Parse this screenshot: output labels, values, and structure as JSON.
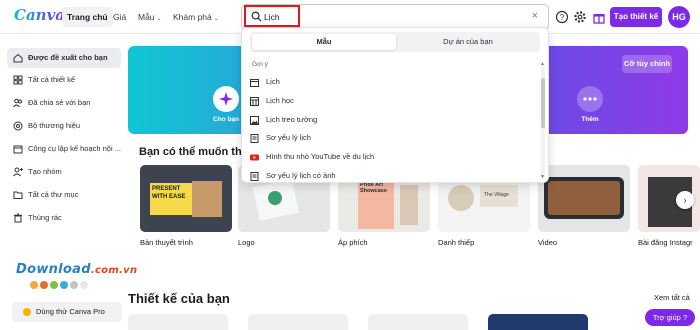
{
  "app": {
    "logo": "Canva"
  },
  "nav": [
    {
      "label": "Trang chủ",
      "active": true
    },
    {
      "label": "Giá"
    },
    {
      "label": "Mẫu",
      "caret": "⌄"
    },
    {
      "label": "Khám phá",
      "caret": "⌄"
    }
  ],
  "search": {
    "value": "Lịch",
    "placeholder": ""
  },
  "topbar": {
    "create_label": "Tạo thiết kế",
    "avatar": "HG"
  },
  "sidebar": {
    "items": [
      {
        "label": "Được đề xuất cho bạn",
        "icon": "home-icon",
        "active": true
      },
      {
        "label": "Tất cả thiết kế",
        "icon": "grid-icon"
      },
      {
        "label": "Đã chia sẻ với bạn",
        "icon": "users-icon"
      },
      {
        "label": "Bộ thương hiệu",
        "icon": "brand-icon"
      },
      {
        "label": "Công cụ lập kế hoạch nội ...",
        "icon": "calendar-icon"
      },
      {
        "label": "Tạo nhóm",
        "icon": "add-team-icon"
      },
      {
        "label": "Tất cả thư mục",
        "icon": "folder-icon"
      },
      {
        "label": "Thùng rác",
        "icon": "trash-icon"
      }
    ],
    "pro_label": "Dùng thử Canva Pro"
  },
  "watermark": {
    "main": "Download",
    "suffix": ".com.vn"
  },
  "banner": {
    "custom_label": "Cỡ tùy chỉnh",
    "categories": [
      {
        "label": "Cho bạn",
        "active": true
      },
      {
        "label": "Thêm"
      }
    ]
  },
  "section": {
    "title": "Bạn có thể muốn thử...",
    "tiles": [
      {
        "label": "Bản thuyết trình",
        "text": "PRESENT WITH EASE"
      },
      {
        "label": "Logo"
      },
      {
        "label": "Áp phích",
        "text": "Pride Art Showcase"
      },
      {
        "label": "Danh thiếp",
        "text": "The Village"
      },
      {
        "label": "Video"
      },
      {
        "label": "Bài đăng Instagr"
      }
    ]
  },
  "section2": {
    "title": "Thiết kế của bạn",
    "see_all": "Xem tất cả"
  },
  "help": {
    "label": "Trợ giúp ?"
  },
  "dropdown": {
    "tabs": [
      {
        "label": "Mẫu",
        "active": true
      },
      {
        "label": "Dự án của bạn"
      }
    ],
    "suggest_heading": "Gợi ý",
    "suggestions": [
      {
        "label": "Lịch",
        "icon": "calendar-icon"
      },
      {
        "label": "Lịch học",
        "icon": "calendar-grid-icon"
      },
      {
        "label": "Lịch treo tường",
        "icon": "image-icon"
      },
      {
        "label": "Sơ yếu lý lịch",
        "icon": "document-icon"
      },
      {
        "label": "Hình thu nhỏ YouTube về du lịch",
        "icon": "youtube-icon"
      },
      {
        "label": "Sơ yếu lý lịch có ảnh",
        "icon": "document-icon"
      }
    ]
  },
  "colors": {
    "brand": "#7d2ae8",
    "highlight": "#e8151c",
    "youtube": "#e62117"
  }
}
